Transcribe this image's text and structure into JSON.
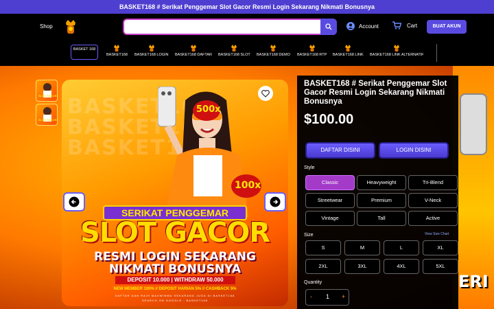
{
  "announcement": "BASKET168 # Serikat Penggemar Slot Gacor Resmi Login Sekarang Nikmati Bonusnya",
  "header": {
    "shop": "Shop",
    "search_placeholder": "",
    "account": "Account",
    "cart": "Cart",
    "signup": "BUAT AKUN"
  },
  "nav": {
    "first": "BASKET 168",
    "items": [
      "BASKET168",
      "BASKET168 LOGIN",
      "BASKET168 DAFTAR",
      "BASKET168 SLOT",
      "BASKET168 DEMO",
      "BASKET168 RTP",
      "BASKET168 LINK",
      "BASKET168 LINK ALTERNATIF"
    ]
  },
  "hero": {
    "bg_word": "BASKET168",
    "sticker": "500x",
    "sticker2": "100x",
    "thumb_label": "SLOT GACOR",
    "line1": "SERIKAT PENGGEMAR",
    "line2": "SLOT GACOR",
    "line3": "RESMI LOGIN SEKARANG",
    "line4": "NIKMATI BONUSNYA",
    "deposit": "DEPOSIT 10.000  |  WITHDRAW 50.000",
    "promo": "NEW MEMBER 100% // DEPOSIT HARIAN 5% // CASHBACK 5%",
    "promo2": "DAFTAR DAN RAIH MAXWINMU SEKARANG JUGA DI BASKET168",
    "search_hint": "SEARCH ON GOOGLE : BASKET168"
  },
  "product": {
    "title": "BASKET168 # Serikat Penggemar Slot Gacor Resmi Login Sekarang Nikmati Bonusnya",
    "price": "$100.00",
    "btn_daftar": "DAFTAR DISINI",
    "btn_login": "LOGIN DISINI",
    "style_label": "Style",
    "styles": [
      "Classic",
      "Heavyweight",
      "Tri-Blend",
      "Streetwear",
      "Premium",
      "V-Neck",
      "Vintage",
      "Tall",
      "Active"
    ],
    "size_label": "Size",
    "size_chart": "View Size Chart",
    "sizes": [
      "S",
      "M",
      "L",
      "XL",
      "2XL",
      "3XL",
      "4XL",
      "5XL"
    ],
    "quantity_label": "Quantity",
    "quantity": "1",
    "minus": "-",
    "plus": "+"
  },
  "right_strip_text": "ERI",
  "colors": {
    "accent": "#5a4be0",
    "selected": "#a33ac8",
    "announce": "#4f3fd0"
  },
  "icons": [
    "search-icon",
    "account-icon",
    "cart-icon",
    "crown-logo-icon",
    "heart-icon",
    "arrow-left-icon",
    "arrow-right-icon"
  ]
}
